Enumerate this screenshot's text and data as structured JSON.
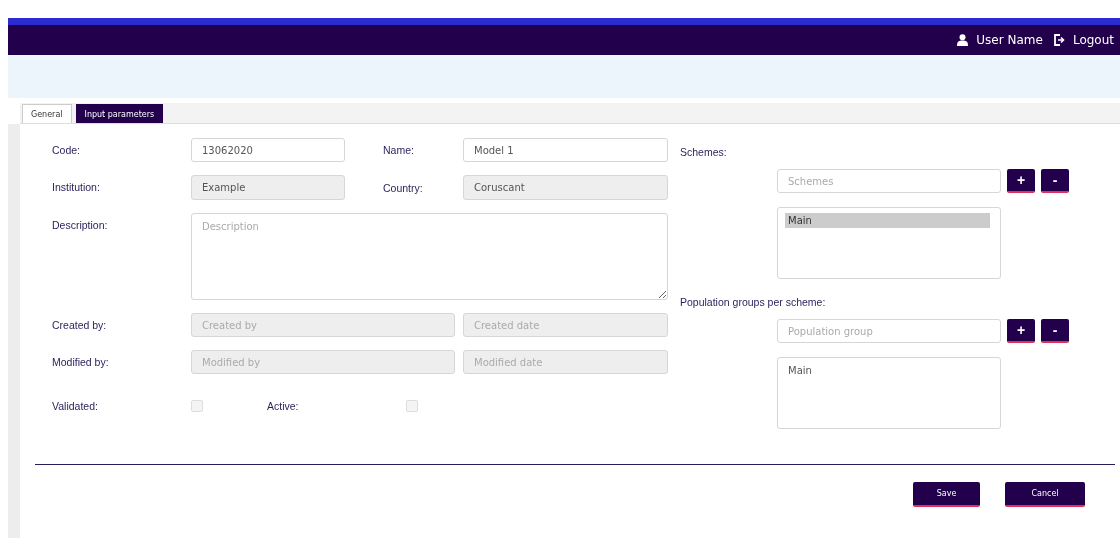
{
  "header": {
    "user_name": "User Name",
    "logout": "Logout"
  },
  "tabs": [
    {
      "label": "General",
      "selected": true
    },
    {
      "label": "Input parameters",
      "selected": false
    }
  ],
  "form": {
    "code": {
      "label": "Code:",
      "value": "13062020",
      "disabled": false
    },
    "name": {
      "label": "Name:",
      "value": "Model 1",
      "disabled": false
    },
    "institution": {
      "label": "Institution:",
      "value": "Example",
      "disabled": true
    },
    "country": {
      "label": "Country:",
      "value": "Coruscant",
      "disabled": true
    },
    "description": {
      "label": "Description:",
      "placeholder": "Description",
      "disabled": false
    },
    "created_by": {
      "label": "Created by:",
      "placeholder": "Created by",
      "disabled": true
    },
    "created_date": {
      "placeholder": "Created date",
      "disabled": true
    },
    "modified_by": {
      "label": "Modified by:",
      "placeholder": "Modified by",
      "disabled": true
    },
    "modified_date": {
      "placeholder": "Modified date",
      "disabled": true
    },
    "validated": {
      "label": "Validated:",
      "checked": false,
      "disabled": true
    },
    "active": {
      "label": "Active:",
      "checked": false,
      "disabled": true
    }
  },
  "schemes": {
    "label": "Schemes:",
    "placeholder": "Schemes",
    "add": "+",
    "remove": "-",
    "items": [
      {
        "text": "Main",
        "selected": true
      }
    ]
  },
  "population_groups": {
    "label": "Population groups per scheme:",
    "placeholder": "Population group",
    "add": "+",
    "remove": "-",
    "items": [
      {
        "text": "Main",
        "selected": false
      }
    ]
  },
  "buttons": [
    "Save",
    "Cancel"
  ]
}
